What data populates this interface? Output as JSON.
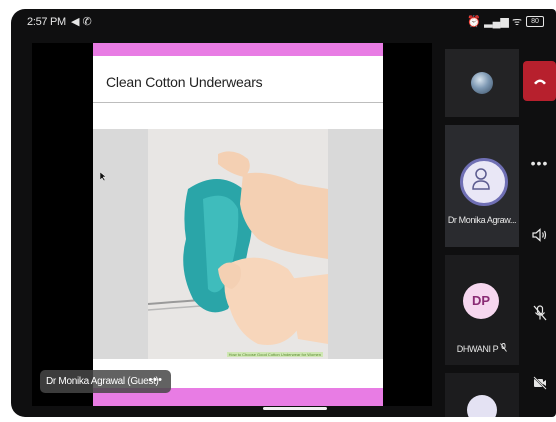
{
  "status_bar": {
    "time": "2:57 PM",
    "left_icons": "◀ ✆",
    "right_icons": "⏰ ▂▄▆ ᯤ",
    "battery": "80"
  },
  "slide": {
    "title": "Clean Cotton Underwears",
    "caption": "How to Choose Good Cotton Underwear for Women"
  },
  "presenter_tag": {
    "name": "Dr Monika Agrawal (Guest)",
    "more": "•••"
  },
  "participants": [
    {
      "name": "",
      "avatar": "photo"
    },
    {
      "name": "Dr Monika Agraw...",
      "avatar": "person-icon"
    },
    {
      "name": "DHWANI P",
      "initials": "DP",
      "avatar": "initials"
    },
    {
      "name": "",
      "avatar": "partial"
    }
  ],
  "controls": {
    "end_call": "end-call-icon",
    "more": "•••",
    "speaker": "speaker-icon",
    "mic": "mic-off-icon",
    "camera": "camera-off-icon"
  },
  "colors": {
    "end_call": "#b7202d",
    "slide_accent": "#e87ce4",
    "dp_avatar": "#f6d7ef"
  }
}
